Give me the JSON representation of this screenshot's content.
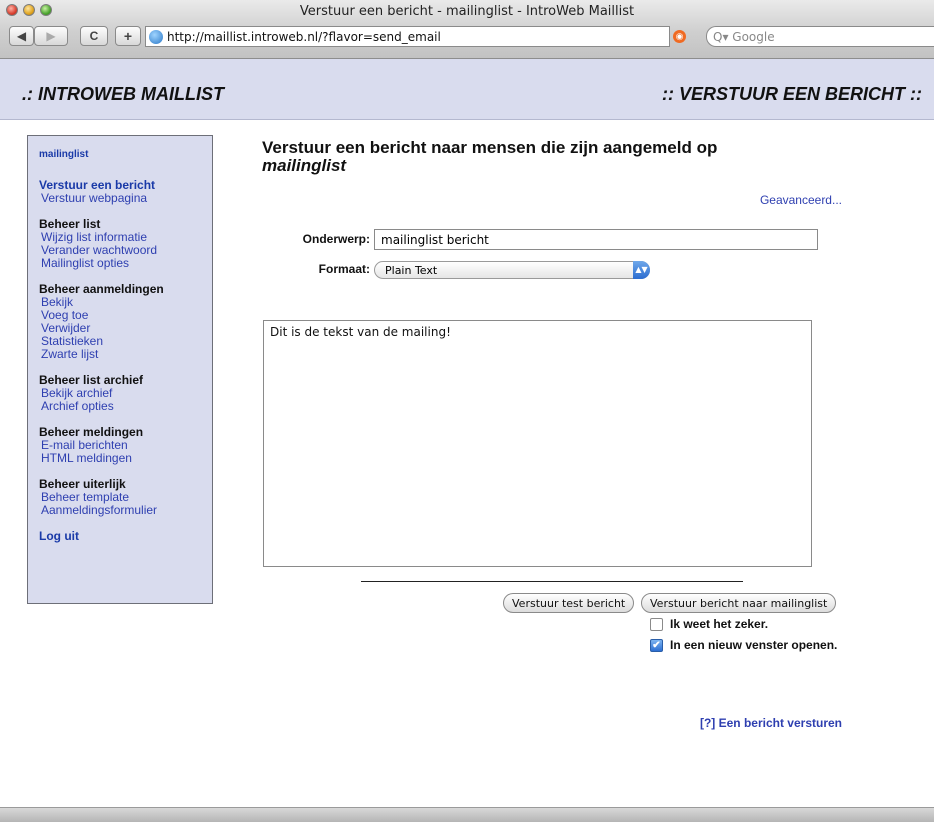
{
  "window": {
    "title": "Verstuur een bericht - mailinglist - IntroWeb Maillist"
  },
  "toolbar": {
    "back": "◀",
    "forward": "▶",
    "reload": "C",
    "add": "+",
    "url": "http://maillist.introweb.nl/?flavor=send_email",
    "search_placeholder": "Q▾ Google"
  },
  "header": {
    "brand": ".: INTROWEB MAILLIST",
    "section": ":: VERSTUUR EEN BERICHT ::"
  },
  "sidebar": {
    "list_name": "mailinglist",
    "groups": [
      {
        "head": "Verstuur een bericht",
        "items": [
          "Verstuur webpagina"
        ]
      },
      {
        "head": "Beheer list",
        "items": [
          "Wijzig list informatie",
          "Verander wachtwoord",
          "Mailinglist opties"
        ]
      },
      {
        "head": "Beheer aanmeldingen",
        "items": [
          "Bekijk",
          "Voeg toe",
          "Verwijder",
          "Statistieken",
          "Zwarte lijst"
        ]
      },
      {
        "head": "Beheer list archief",
        "items": [
          "Bekijk archief",
          "Archief opties"
        ]
      },
      {
        "head": "Beheer meldingen",
        "items": [
          "E-mail berichten",
          "HTML meldingen"
        ]
      },
      {
        "head": "Beheer uiterlijk",
        "items": [
          "Beheer template",
          "Aanmeldingsformulier"
        ]
      }
    ],
    "logout": "Log uit"
  },
  "main": {
    "title": "Verstuur een bericht naar mensen die zijn aangemeld op",
    "title_list": "mailinglist",
    "advanced": "Geavanceerd...",
    "subject_label": "Onderwerp:",
    "subject_value": "mailinglist bericht",
    "format_label": "Formaat:",
    "format_value": "Plain Text",
    "message": "Dit is de tekst van de mailing!",
    "test_button": "Verstuur test bericht",
    "send_button": "Verstuur bericht naar mailinglist",
    "confirm_label": "Ik weet het zeker.",
    "confirm_checked": false,
    "newwindow_label": "In een nieuw venster openen.",
    "newwindow_checked": true,
    "help": "[?] Een bericht versturen"
  }
}
